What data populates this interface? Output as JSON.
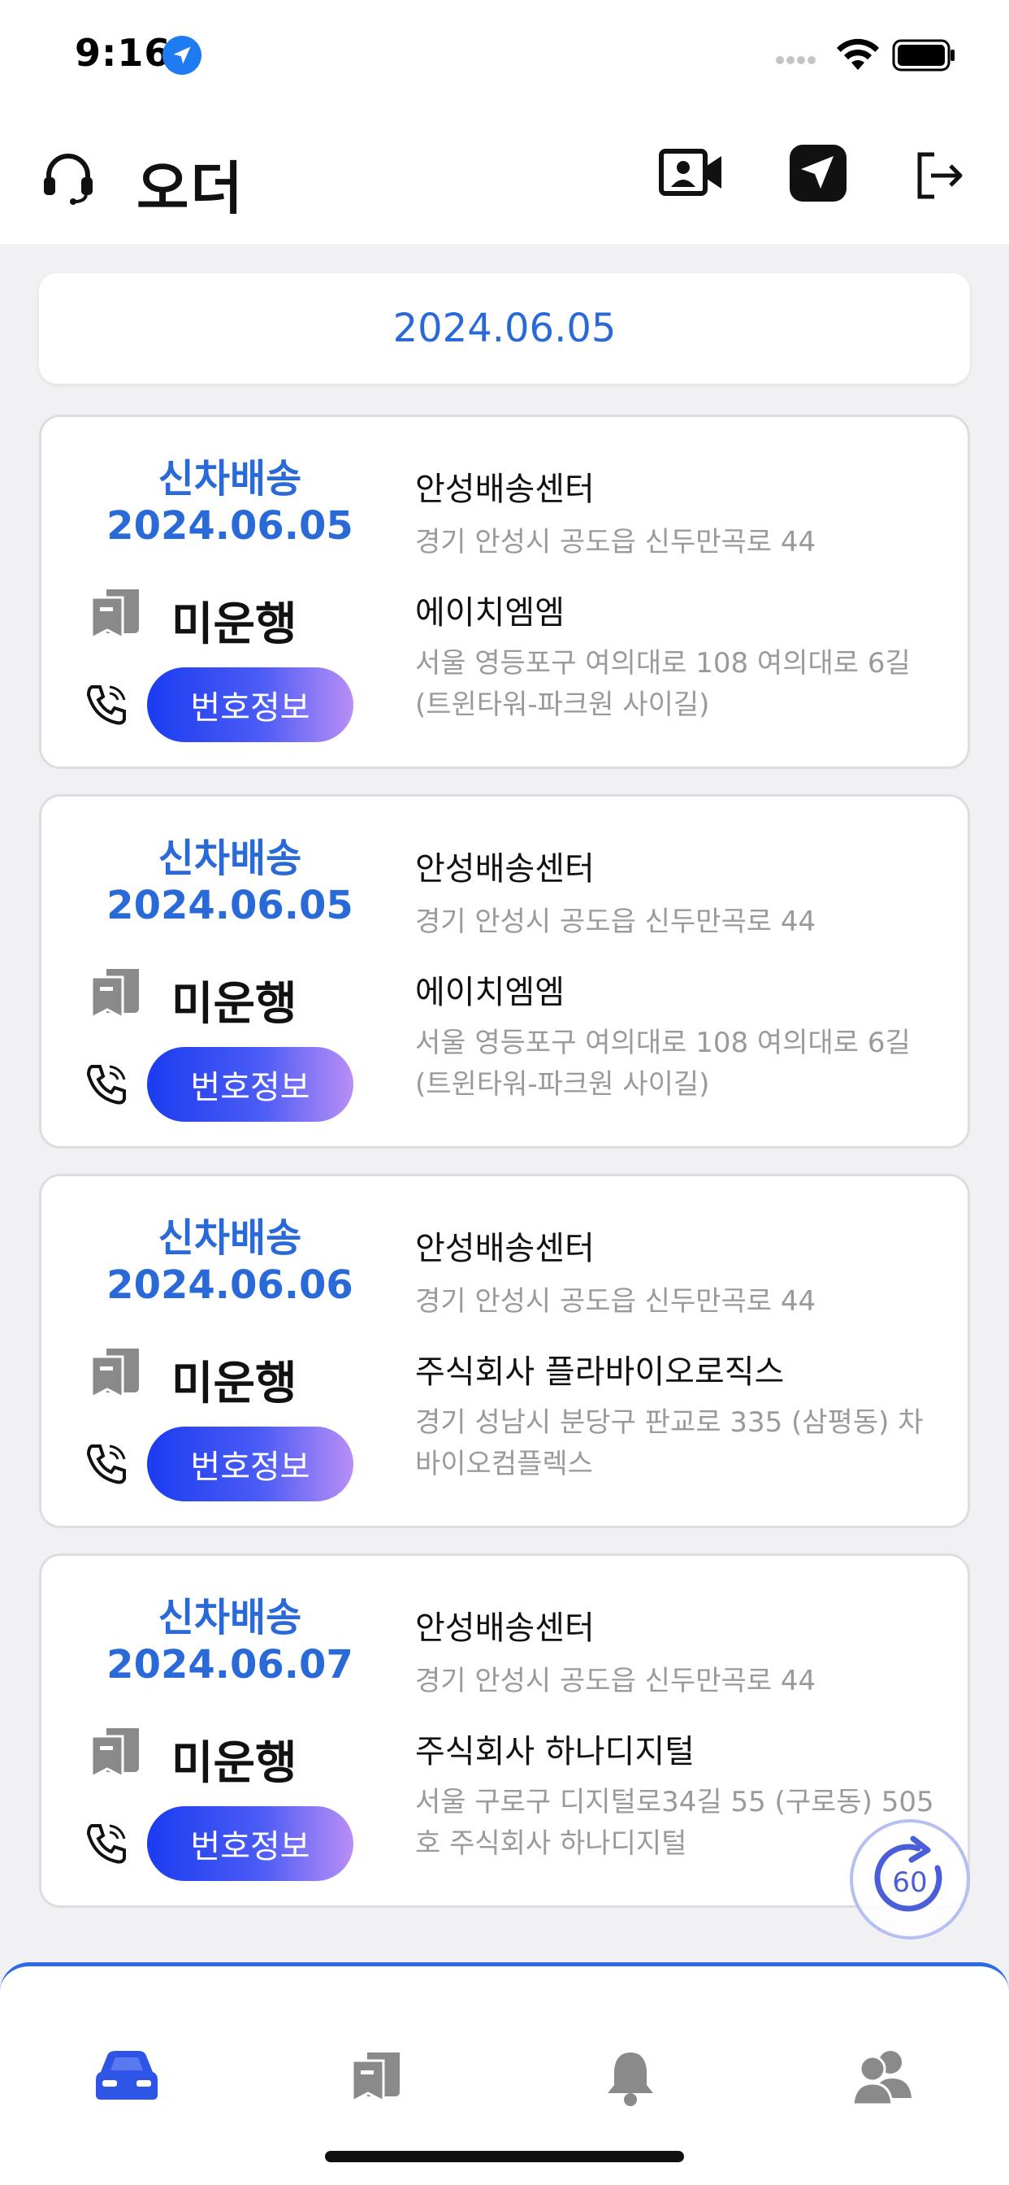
{
  "status_bar": {
    "time": "9:16"
  },
  "header": {
    "title": "오더"
  },
  "date_bar": {
    "date": "2024.06.05"
  },
  "orders": [
    {
      "type": "신차배송",
      "date": "2024.06.05",
      "status": "미운행",
      "button_label": "번호정보",
      "origin_name": "안성배송센터",
      "origin_address": "경기 안성시 공도읍 신두만곡로 44",
      "dest_name": "에이치엠엠",
      "dest_address": "서울 영등포구 여의대로 108 여의대로 6길 (트윈타워-파크원 사이길)"
    },
    {
      "type": "신차배송",
      "date": "2024.06.05",
      "status": "미운행",
      "button_label": "번호정보",
      "origin_name": "안성배송센터",
      "origin_address": "경기 안성시 공도읍 신두만곡로 44",
      "dest_name": "에이치엠엠",
      "dest_address": "서울 영등포구 여의대로 108 여의대로 6길 (트윈타워-파크원 사이길)"
    },
    {
      "type": "신차배송",
      "date": "2024.06.06",
      "status": "미운행",
      "button_label": "번호정보",
      "origin_name": "안성배송센터",
      "origin_address": "경기 안성시 공도읍 신두만곡로 44",
      "dest_name": "주식회사 플라바이오로직스",
      "dest_address": "경기 성남시 분당구 판교로 335 (삼평동) 차바이오컴플렉스"
    },
    {
      "type": "신차배송",
      "date": "2024.06.07",
      "status": "미운행",
      "button_label": "번호정보",
      "origin_name": "안성배송센터",
      "origin_address": "경기 안성시 공도읍 신두만곡로 44",
      "dest_name": "주식회사 하나디지털",
      "dest_address": "서울 구로구 디지털로34길 55 (구로동) 505호 주식회사 하나디지털"
    }
  ],
  "refresh": {
    "count": "60"
  },
  "tabs": [
    {
      "icon": "car-icon",
      "active": true,
      "color": "#2f55e6"
    },
    {
      "icon": "book-icon",
      "active": false,
      "color": "#8a8a8a"
    },
    {
      "icon": "bell-icon",
      "active": false,
      "color": "#8a8a8a"
    },
    {
      "icon": "users-icon",
      "active": false,
      "color": "#8a8a8a"
    }
  ],
  "colors": {
    "accent": "#2a69d8",
    "tab_border": "#2e6be6"
  }
}
